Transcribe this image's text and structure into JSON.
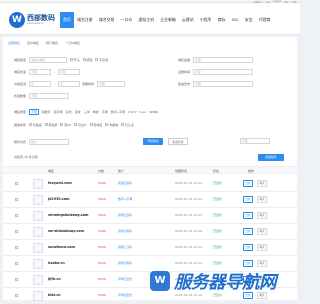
{
  "topbar": {
    "links": [
      "帮助中心",
      "中文",
      "English",
      "登录",
      "注册"
    ]
  },
  "brand": {
    "name": "西部数码",
    "site": "www.west.cn",
    "mark": "W"
  },
  "nav": {
    "items": [
      "首页",
      "域名注册",
      "域名交易",
      "一口价",
      "虚拟主机",
      "企业邮箱",
      "云建站",
      "小程序",
      "商标",
      "SSL",
      "安全",
      "代理商"
    ],
    "active_index": 0,
    "phone": "400-..."
  },
  "subtabs": [
    "全部域名",
    "竞价域名",
    "预订域名",
    "一口价域名"
  ],
  "filters": {
    "domain_label": "域名搜索",
    "domain_placeholder": "请输入域名",
    "opt_start": "开头",
    "opt_end": "结尾",
    "opt_exclude": "不包含",
    "suffix_label": "域名后缀",
    "suffix_value": "全部",
    "len_label": "域名长度",
    "len_from": "不限",
    "len_to": "不限",
    "price_label": "价格区间",
    "price_placeholder": "元",
    "regdate_label": "注册时间",
    "regdate_value": "不限",
    "expire_label": "到期时间",
    "expire_value": "不限",
    "history_label": "建站历史",
    "history_value": "不限",
    "backlink_label": "外链数量",
    "backlink_value": "不限",
    "type_label": "域名类型",
    "types": [
      "不限",
      "纯数字",
      "纯字母",
      "杂米",
      "双拼",
      "三拼",
      "单拼",
      "声母",
      "数字+字母",
      "CVCV",
      "LLLL",
      "NNNN"
    ],
    "extra_label": "其他条件",
    "extras": [
      "有备案",
      "有收录",
      "有PR",
      "可过户",
      "老域名",
      "未被墙",
      "已认证"
    ],
    "sort_label": "排序方式",
    "sort_value": "默认",
    "search_button": "开始搜索",
    "reset_button": "重置条件",
    "order_label": "不限",
    "batch_button": "批量操作"
  },
  "result_text": "共找到 16 条记录",
  "table": {
    "headers": [
      "",
      "域名",
      "价格",
      "简介",
      "到期时间",
      "状态",
      "操作"
    ],
    "rows": [
      {
        "domain": "foxyumi.com",
        "price": "¥400",
        "desc": "英语(双拼)",
        "date": "2025-02-18 12:00",
        "status": "已竞价"
      },
      {
        "domain": "jd1939.com",
        "price": "¥420",
        "desc": "数字+字母",
        "date": "2025-02-18 12:02",
        "status": "已竞价"
      },
      {
        "domain": "xinmingshuiseng.com",
        "price": "¥450",
        "desc": "拼音(五拼)",
        "date": "2025-02-18 12:05",
        "status": "已竞价"
      },
      {
        "domain": "wz-shiwaiduoy.com",
        "price": "¥480",
        "desc": "杂米(双拼)",
        "date": "2025-02-18 12:08",
        "status": "已竞价"
      },
      {
        "domain": "xunzhuna.com",
        "price": "¥500",
        "desc": "拼音(三拼)",
        "date": "2025-02-18 12:10",
        "status": "已竞价"
      },
      {
        "domain": "haoke.cn",
        "price": "¥520",
        "desc": "拼音(双拼)",
        "date": "2025-02-18 12:12",
        "status": "已竞价"
      },
      {
        "domain": "jijfh.cn",
        "price": "¥550",
        "desc": "字母(五位)",
        "date": "2025-02-18 12:15",
        "status": "已竞价"
      },
      {
        "domain": "kikt.cn",
        "price": "¥580",
        "desc": "字母(四位)",
        "date": "2025-02-18 12:18",
        "status": "已竞价"
      }
    ],
    "action_bid": "出价",
    "action_buy": "购买"
  },
  "watermark": {
    "text": "服务器导航网",
    "mark": "W"
  },
  "colors": {
    "accent": "#2c8cf0",
    "brand": "#1f6fcf",
    "price": "#e0442c",
    "status": "#1aa260"
  }
}
